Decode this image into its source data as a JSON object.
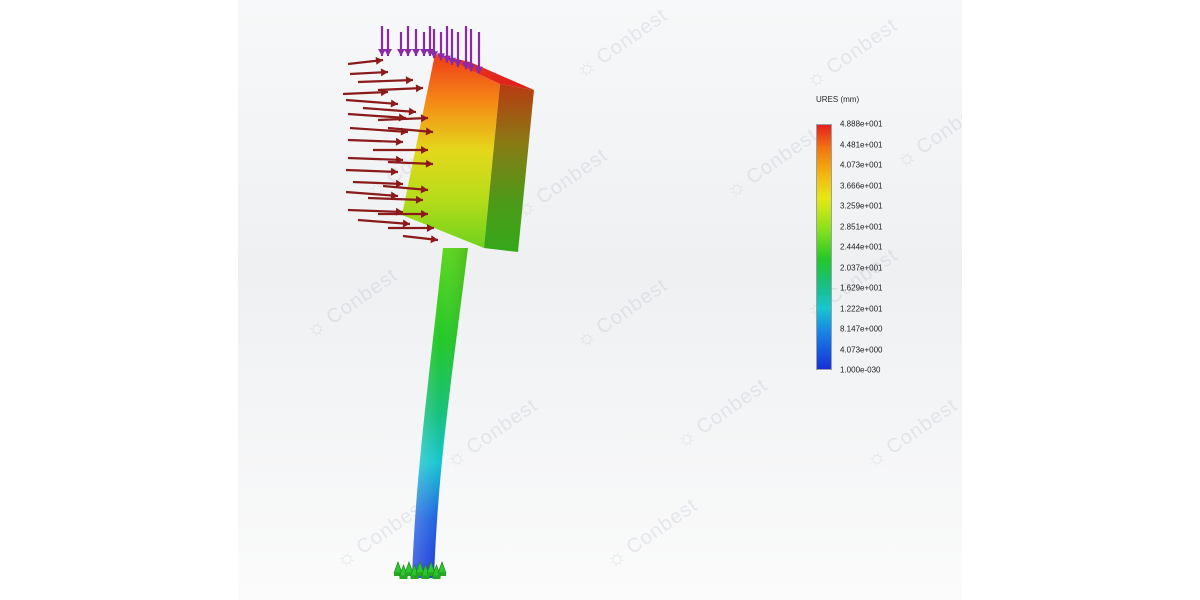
{
  "legend": {
    "title": "URES (mm)",
    "ticks": [
      "4.888e+001",
      "4.481e+001",
      "4.073e+001",
      "3.666e+001",
      "3.259e+001",
      "2.851e+001",
      "2.444e+001",
      "2.037e+001",
      "1.629e+001",
      "1.222e+001",
      "8.147e+000",
      "4.073e+000",
      "1.000e-030"
    ]
  },
  "watermark": "Conbest",
  "colors": {
    "max": "#e81f1f",
    "min": "#1530d8",
    "load_arrow": "#8b1a1a",
    "pressure_arrow": "#8a2aa8",
    "fixture": "#2fc52f"
  },
  "icons": {
    "load": "horizontal-force-arrows",
    "pressure": "vertical-force-arrows",
    "fixture": "fixed-support-icon"
  }
}
